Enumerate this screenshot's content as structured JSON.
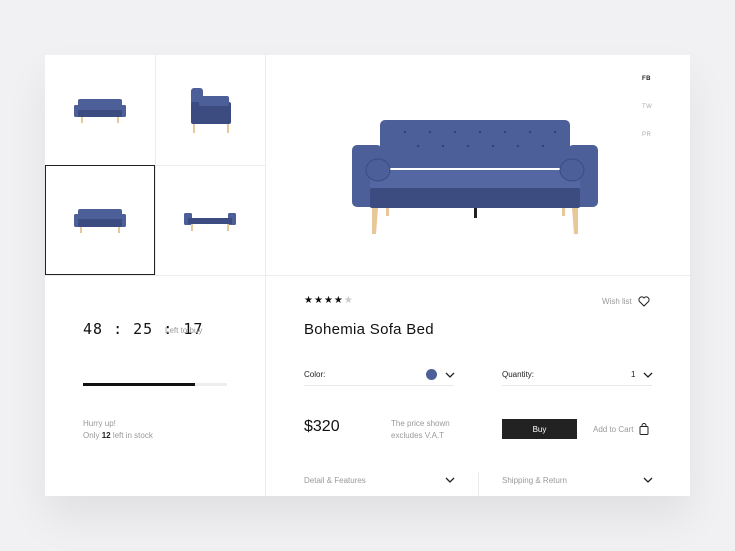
{
  "product": {
    "name": "Bohemia Sofa Bed",
    "rating": 4,
    "rating_max": 5,
    "price": "$320",
    "price_note": [
      "The price shown",
      "excludes V.A.T"
    ]
  },
  "social": [
    "FB",
    "TW",
    "PR"
  ],
  "social_active": "FB",
  "countdown": {
    "hours": "48",
    "minutes": "25",
    "seconds": "17",
    "separator": ":",
    "label": "Left to buy"
  },
  "stock": {
    "progress": 0.78,
    "line1": "Hurry up!",
    "prefix": "Only",
    "count": "12",
    "suffix": "left in stock"
  },
  "wish_label": "Wish list",
  "color": {
    "label": "Color:",
    "value": "#4d5f98"
  },
  "quantity": {
    "label": "Quantity:",
    "value": "1"
  },
  "buy_label": "Buy",
  "cart_label": "Add to Cart",
  "accordions": {
    "details": "Detail & Features",
    "shipping": "Shipping & Return"
  },
  "colors": {
    "sofa": "#4d5f98",
    "sofa_dark": "#3c4c80",
    "legs": "#e8c79b"
  }
}
